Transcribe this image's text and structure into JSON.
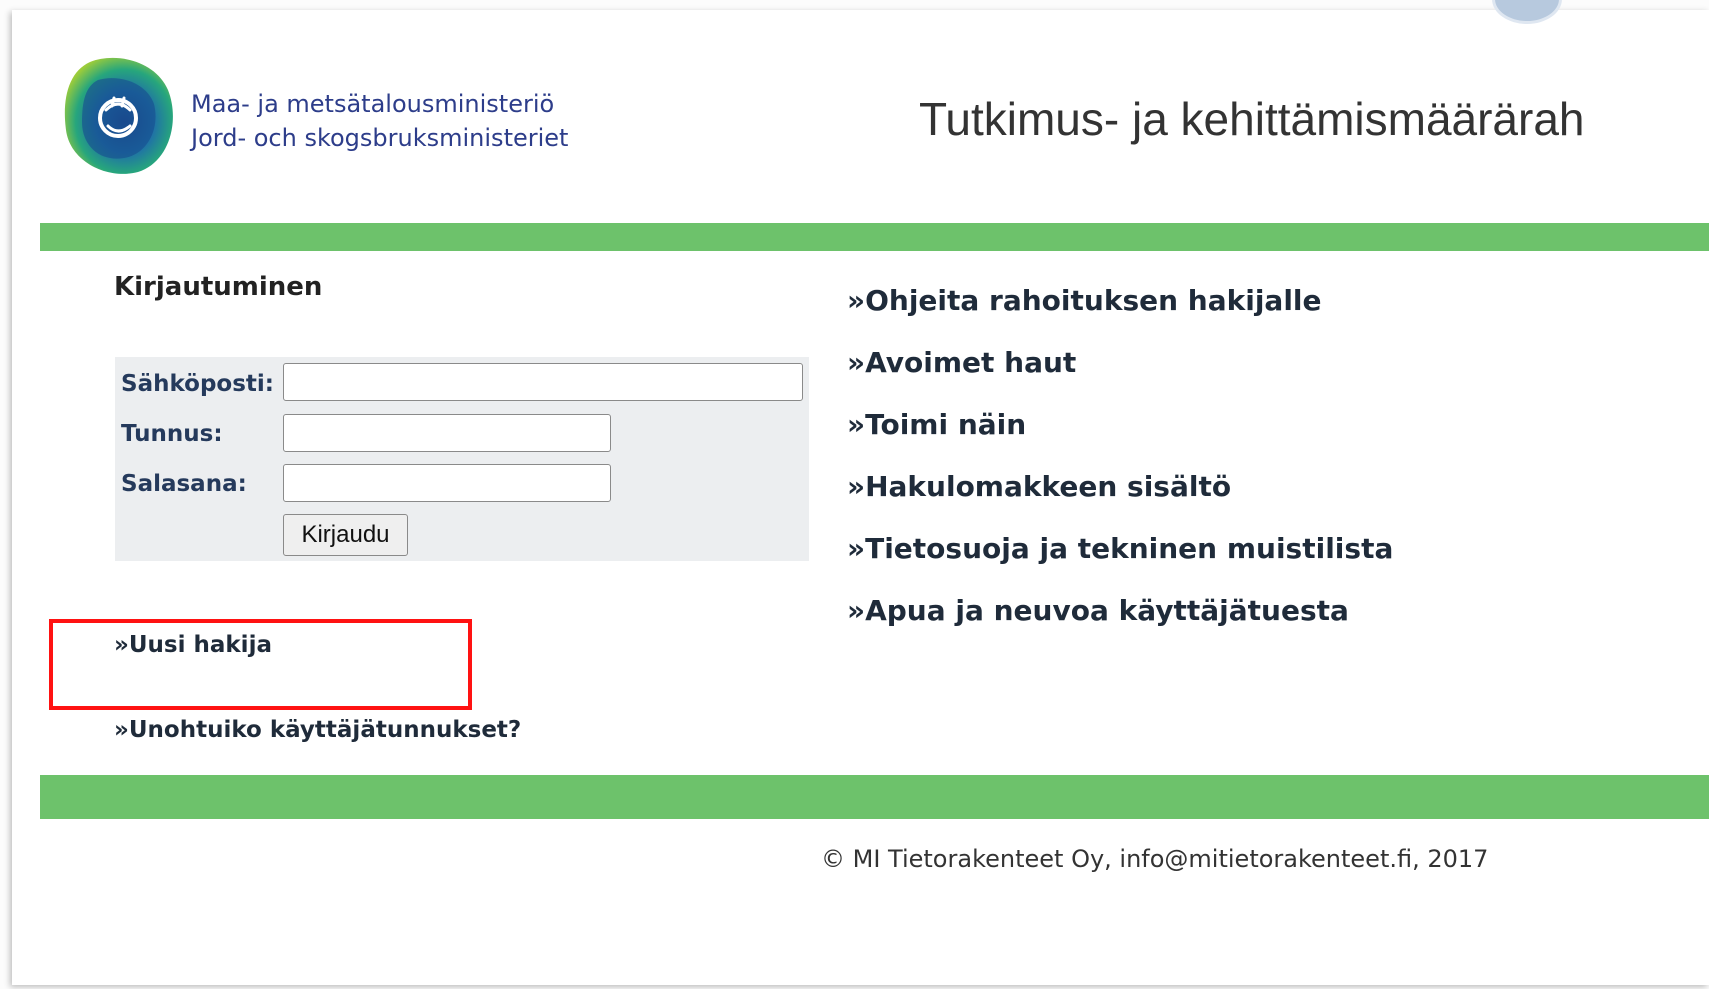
{
  "header": {
    "ministry_fi": "Maa- ja metsätalousministeriö",
    "ministry_sv": "Jord- och skogsbruksministeriet",
    "site_title": "Tutkimus- ja kehittämismäärärah"
  },
  "login": {
    "heading": "Kirjautuminen",
    "email_label": "Sähköposti:",
    "email_value": "",
    "username_label": "Tunnus:",
    "username_value": "",
    "password_label": "Salasana:",
    "password_value": "",
    "submit_label": "Kirjaudu"
  },
  "links": {
    "new_applicant": "»Uusi hakija",
    "forgot_credentials": "»Unohtuiko käyttäjätunnukset?"
  },
  "menu": [
    "»Ohjeita rahoituksen hakijalle",
    "»Avoimet haut",
    "»Toimi näin",
    "»Hakulomakkeen sisältö",
    "»Tietosuoja ja tekninen muistilista",
    "»Apua ja neuvoa käyttäjätuesta"
  ],
  "footer": {
    "text": "© MI Tietorakenteet Oy, info@mitietorakenteet.fi, 2017"
  },
  "colors": {
    "accent_green": "#6dc26b",
    "ministry_blue": "#2d3d8a",
    "highlight_red": "#ff1212"
  },
  "icons": {
    "logo": "ministry-lion-emblem-icon"
  }
}
